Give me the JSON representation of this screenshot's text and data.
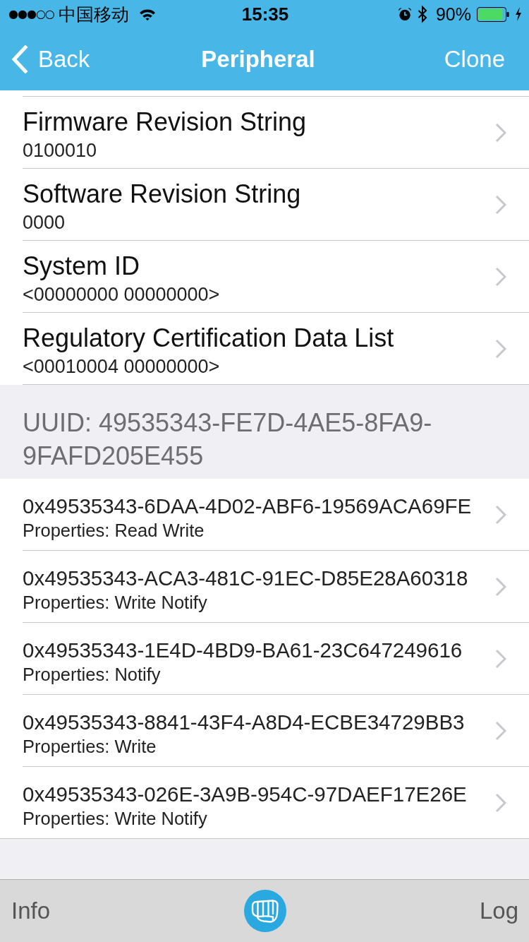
{
  "status_bar": {
    "signal": "●●●○○",
    "carrier": "中国移动",
    "time": "15:35",
    "battery": "90%"
  },
  "nav_bar": {
    "back": "Back",
    "title": "Peripheral",
    "action": "Clone"
  },
  "info_rows": [
    {
      "title": "Firmware Revision String",
      "value": "0100010"
    },
    {
      "title": "Software Revision String",
      "value": "0000"
    },
    {
      "title": "System ID",
      "value": "<00000000 00000000>"
    },
    {
      "title": "Regulatory Certification Data List",
      "value": "<00010004 00000000>"
    }
  ],
  "service": {
    "header": "UUID: 49535343-FE7D-4AE5-8FA9-9FAFD205E455",
    "characteristics": [
      {
        "uuid": "0x49535343-6DAA-4D02-ABF6-19569ACA69FE",
        "properties": "Properties: Read Write"
      },
      {
        "uuid": "0x49535343-ACA3-481C-91EC-D85E28A60318",
        "properties": "Properties: Write Notify"
      },
      {
        "uuid": "0x49535343-1E4D-4BD9-BA61-23C647249616",
        "properties": "Properties: Notify"
      },
      {
        "uuid": "0x49535343-8841-43F4-A8D4-ECBE34729BB3",
        "properties": "Properties: Write"
      },
      {
        "uuid": "0x49535343-026E-3A9B-954C-97DAEF17E26E",
        "properties": "Properties: Write Notify"
      }
    ]
  },
  "tab_bar": {
    "left": "Info",
    "right": "Log"
  }
}
